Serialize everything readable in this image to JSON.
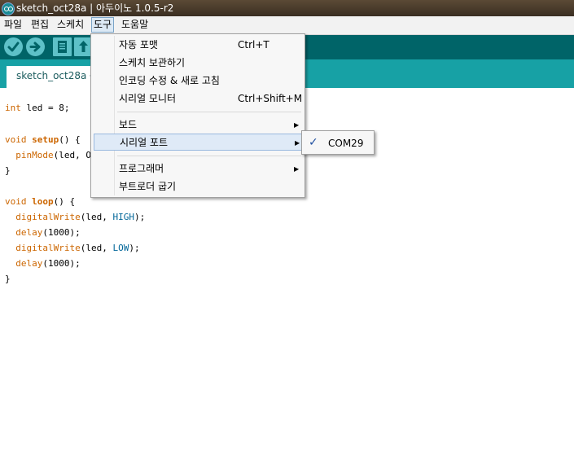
{
  "window": {
    "title": "sketch_oct28a | 아두이노 1.0.5-r2"
  },
  "menubar": {
    "items": [
      {
        "label": "파일"
      },
      {
        "label": "편집"
      },
      {
        "label": "스케치"
      },
      {
        "label": "도구",
        "active": true
      },
      {
        "label": "도움말"
      }
    ]
  },
  "toolbar": {
    "buttons": [
      "verify-icon",
      "upload-icon",
      "new-icon",
      "open-icon"
    ]
  },
  "tabs": [
    {
      "label": "sketch_oct28a §"
    }
  ],
  "editor": {
    "lines": [
      "int led = 8;",
      "",
      "void setup() {",
      "  pinMode(led, OUTPUT);",
      "}",
      "",
      "void loop() {",
      "  digitalWrite(led, HIGH);",
      "  delay(1000);",
      "  digitalWrite(led, LOW);",
      "  delay(1000);",
      "}"
    ],
    "visible_fragments": {
      "l1_type": "int",
      "l1_rest": " led = 8;",
      "l3_type": "void",
      "l3_fn": "setup",
      "l3_rest": "() {",
      "l4_fn": "pinMode",
      "l4_rest": "(led, OUT",
      "l5": "}",
      "l7_type": "void",
      "l7_fn": "loop",
      "l7_rest": "() {",
      "l8_fn": "digitalWrite",
      "l8_a": "(led, ",
      "l8_c": "HIGH",
      "l8_b": ");",
      "l9_fn": "delay",
      "l9_rest": "(1000);",
      "l10_fn": "digitalWrite",
      "l10_a": "(led, ",
      "l10_c": "LOW",
      "l10_b": ");",
      "l11_fn": "delay",
      "l11_rest": "(1000);",
      "l12": "}"
    }
  },
  "tools_menu": {
    "items": [
      {
        "label": "자동 포맷",
        "shortcut": "Ctrl+T"
      },
      {
        "label": "스케치 보관하기",
        "shortcut": ""
      },
      {
        "label": "인코딩 수정 & 새로 고침",
        "shortcut": ""
      },
      {
        "label": "시리얼 모니터",
        "shortcut": "Ctrl+Shift+M"
      },
      {
        "label": "보드",
        "submenu": true
      },
      {
        "label": "시리얼 포트",
        "submenu": true,
        "highlighted": true
      },
      {
        "label": "프로그래머",
        "submenu": true
      },
      {
        "label": "부트로더 굽기",
        "shortcut": ""
      }
    ],
    "arrow_glyph": "▶"
  },
  "serial_port_submenu": {
    "items": [
      {
        "label": "COM29",
        "checked": true,
        "check_glyph": "✓"
      }
    ]
  },
  "colors": {
    "toolbar": "#006468",
    "tab_strip": "#17a1a5",
    "button": "#5ec1c8",
    "keyword": "#cc6600",
    "constant": "#006699"
  }
}
